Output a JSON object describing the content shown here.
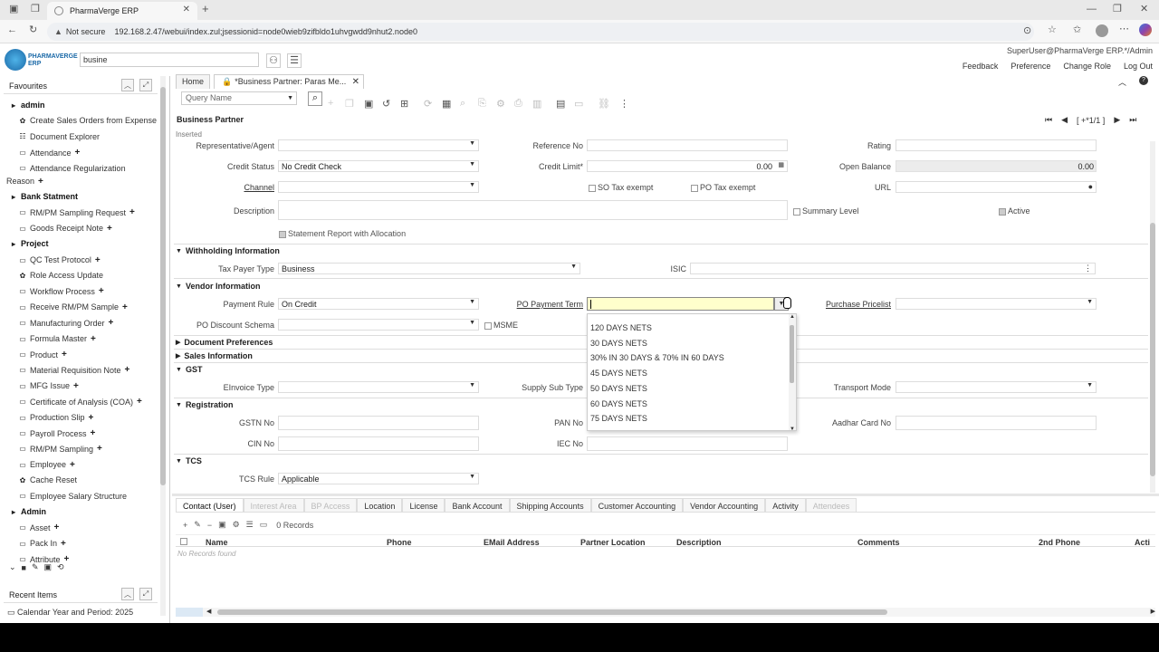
{
  "browser": {
    "tab_title": "PharmaVerge ERP",
    "security_label": "Not secure",
    "url": "192.168.2.47/webui/index.zul;jsessionid=node0wieb9zifbldo1uhvgwdd9nhut2.node0"
  },
  "header": {
    "logo_line1": "PHARMAVERGE",
    "logo_line2": "ERP",
    "search_value": "busine",
    "user": "SuperUser@PharmaVerge ERP.*/Admin",
    "links": [
      "Feedback",
      "Preference",
      "Change Role",
      "Log Out"
    ]
  },
  "sidebar": {
    "favourites_title": "Favourites",
    "recent_title": "Recent Items",
    "recent_item": "Calendar Year and Period: 2025",
    "items": [
      {
        "label": "admin",
        "icon": "folder-icon",
        "bold": true,
        "plus": false
      },
      {
        "label": "Create Sales Orders from Expense",
        "icon": "gear-icon",
        "bold": false,
        "plus": false
      },
      {
        "label": "Document Explorer",
        "icon": "list-icon",
        "bold": false,
        "plus": false
      },
      {
        "label": "Attendance",
        "icon": "window-icon",
        "bold": false,
        "plus": true
      },
      {
        "label": "Attendance Regularization",
        "icon": "window-icon",
        "bold": false,
        "plus": false
      },
      {
        "label": "Reason",
        "icon": "",
        "bold": false,
        "plus": true
      },
      {
        "label": "Bank Statment",
        "icon": "folder-icon",
        "bold": true,
        "plus": false
      },
      {
        "label": "RM/PM Sampling Request",
        "icon": "window-icon",
        "bold": false,
        "plus": true
      },
      {
        "label": "Goods Receipt Note",
        "icon": "window-icon",
        "bold": false,
        "plus": true
      },
      {
        "label": "Project",
        "icon": "folder-icon",
        "bold": true,
        "plus": false
      },
      {
        "label": "QC Test Protocol",
        "icon": "window-icon",
        "bold": false,
        "plus": true
      },
      {
        "label": "Role Access Update",
        "icon": "gear-icon",
        "bold": false,
        "plus": false
      },
      {
        "label": "Workflow Process",
        "icon": "window-icon",
        "bold": false,
        "plus": true
      },
      {
        "label": "Receive RM/PM Sample",
        "icon": "window-icon",
        "bold": false,
        "plus": true
      },
      {
        "label": "Manufacturing Order",
        "icon": "window-icon",
        "bold": false,
        "plus": true
      },
      {
        "label": "Formula Master",
        "icon": "window-icon",
        "bold": false,
        "plus": true
      },
      {
        "label": "Product",
        "icon": "window-icon",
        "bold": false,
        "plus": true
      },
      {
        "label": "Material Requisition Note",
        "icon": "window-icon",
        "bold": false,
        "plus": true
      },
      {
        "label": "MFG Issue",
        "icon": "window-icon",
        "bold": false,
        "plus": true
      },
      {
        "label": "Certificate of Analysis (COA)",
        "icon": "window-icon",
        "bold": false,
        "plus": true
      },
      {
        "label": "Production Slip",
        "icon": "window-icon",
        "bold": false,
        "plus": true
      },
      {
        "label": "Payroll Process",
        "icon": "window-icon",
        "bold": false,
        "plus": true
      },
      {
        "label": "RM/PM Sampling",
        "icon": "window-icon",
        "bold": false,
        "plus": true
      },
      {
        "label": "Employee",
        "icon": "window-icon",
        "bold": false,
        "plus": true
      },
      {
        "label": "Cache Reset",
        "icon": "gear-icon",
        "bold": false,
        "plus": false
      },
      {
        "label": "Employee Salary Structure",
        "icon": "window-icon",
        "bold": false,
        "plus": false
      },
      {
        "label": "Admin",
        "icon": "folder-icon",
        "bold": true,
        "plus": false
      },
      {
        "label": "Asset",
        "icon": "window-icon",
        "bold": false,
        "plus": true
      },
      {
        "label": "Pack In",
        "icon": "window-icon",
        "bold": false,
        "plus": true
      },
      {
        "label": "Attribute",
        "icon": "window-icon",
        "bold": false,
        "plus": true
      }
    ]
  },
  "tabs": {
    "home": "Home",
    "active": "*Business Partner: Paras Me..."
  },
  "toolbar": {
    "query_placeholder": "Query Name",
    "record_nav": "[ +*1/1 ]"
  },
  "form": {
    "title": "Business Partner",
    "status": "Inserted",
    "representative_label": "Representative/Agent",
    "reference_label": "Reference No",
    "rating_label": "Rating",
    "credit_status_label": "Credit Status",
    "credit_status_value": "No Credit Check",
    "credit_limit_label": "Credit Limit*",
    "credit_limit_value": "0.00",
    "open_balance_label": "Open Balance",
    "open_balance_value": "0.00",
    "channel_label": "Channel",
    "so_tax_label": "SO Tax exempt",
    "po_tax_label": "PO Tax exempt",
    "url_label": "URL",
    "description_label": "Description",
    "summary_label": "Summary Level",
    "active_label": "Active",
    "statement_label": "Statement Report with Allocation",
    "sec_withholding": "Withholding Information",
    "tax_payer_label": "Tax Payer Type",
    "tax_payer_value": "Business",
    "isic_label": "ISIC",
    "sec_vendor": "Vendor Information",
    "payment_rule_label": "Payment Rule",
    "payment_rule_value": "On Credit",
    "po_payment_term_label": "PO Payment Term",
    "purchase_pricelist_label": "Purchase Pricelist",
    "po_discount_label": "PO Discount Schema",
    "msme_label": "MSME",
    "sec_docprefs": "Document Preferences",
    "sec_sales": "Sales Information",
    "sec_gst": "GST",
    "einvoice_label": "EInvoice Type",
    "supply_sub_label": "Supply Sub Type",
    "transport_label": "Transport Mode",
    "sec_registration": "Registration",
    "gstn_label": "GSTN No",
    "pan_label": "PAN No",
    "aadhar_label": "Aadhar Card No",
    "cin_label": "CIN No",
    "iec_label": "IEC No",
    "sec_tcs": "TCS",
    "tcs_rule_label": "TCS Rule",
    "tcs_rule_value": "Applicable"
  },
  "dropdown_options": [
    "120 DAYS NETS",
    "30 DAYS NETS",
    "30% IN 30 DAYS & 70% IN 60 DAYS",
    "45 DAYS NETS",
    "50 DAYS NETS",
    "60 DAYS NETS",
    "75 DAYS NETS"
  ],
  "detail_tabs": [
    {
      "label": "Contact (User)",
      "state": "active"
    },
    {
      "label": "Interest Area",
      "state": "disabled"
    },
    {
      "label": "BP Access",
      "state": "disabled"
    },
    {
      "label": "Location",
      "state": "normal"
    },
    {
      "label": "License",
      "state": "normal"
    },
    {
      "label": "Bank Account",
      "state": "normal"
    },
    {
      "label": "Shipping Accounts",
      "state": "normal"
    },
    {
      "label": "Customer Accounting",
      "state": "normal"
    },
    {
      "label": "Vendor Accounting",
      "state": "normal"
    },
    {
      "label": "Activity",
      "state": "normal"
    },
    {
      "label": "Attendees",
      "state": "disabled"
    }
  ],
  "detail": {
    "records": "0 Records",
    "columns": [
      "Name",
      "Phone",
      "EMail Address",
      "Partner Location",
      "Description",
      "Comments",
      "2nd Phone",
      "Acti"
    ],
    "empty": "No Records found"
  }
}
